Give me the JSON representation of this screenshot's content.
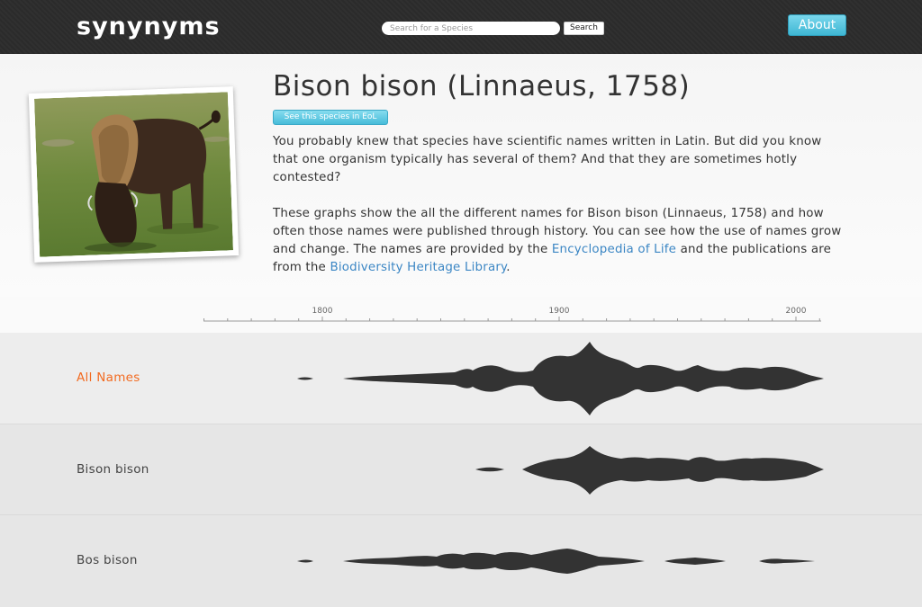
{
  "header": {
    "logo": "synynyms",
    "search_placeholder": "Search for a Species",
    "search_button": "Search",
    "about_button": "About"
  },
  "species": {
    "title": "Bison bison (Linnaeus, 1758)",
    "eol_button": "See this species in EoL",
    "paragraph1": "You probably knew that species have scientific names written in Latin. But did you know that one organism typically has several of them? And that they are sometimes hotly contested?",
    "paragraph2_before": "These graphs show the all the different names for Bison bison (Linnaeus, 1758) and how often those names were published through history. You can see how the use of names grow and change. The names are provided by the ",
    "link_eol": "Encyclopedia of Life",
    "paragraph2_middle": " and the publications are from the ",
    "link_bhl": "Biodiversity Heritage Library",
    "paragraph2_after": "."
  },
  "timeline": {
    "ticks": [
      "1800",
      "1900",
      "2000"
    ],
    "rows": [
      {
        "label": "All Names",
        "active": true
      },
      {
        "label": "Bison bison",
        "active": false
      },
      {
        "label": "Bos bison",
        "active": false
      }
    ]
  },
  "colors": {
    "header_bg": "#2b2b2b",
    "accent_button": "#48bcd9",
    "active_label": "#f26b21",
    "link": "#3b86c4",
    "stream": "#333333"
  }
}
